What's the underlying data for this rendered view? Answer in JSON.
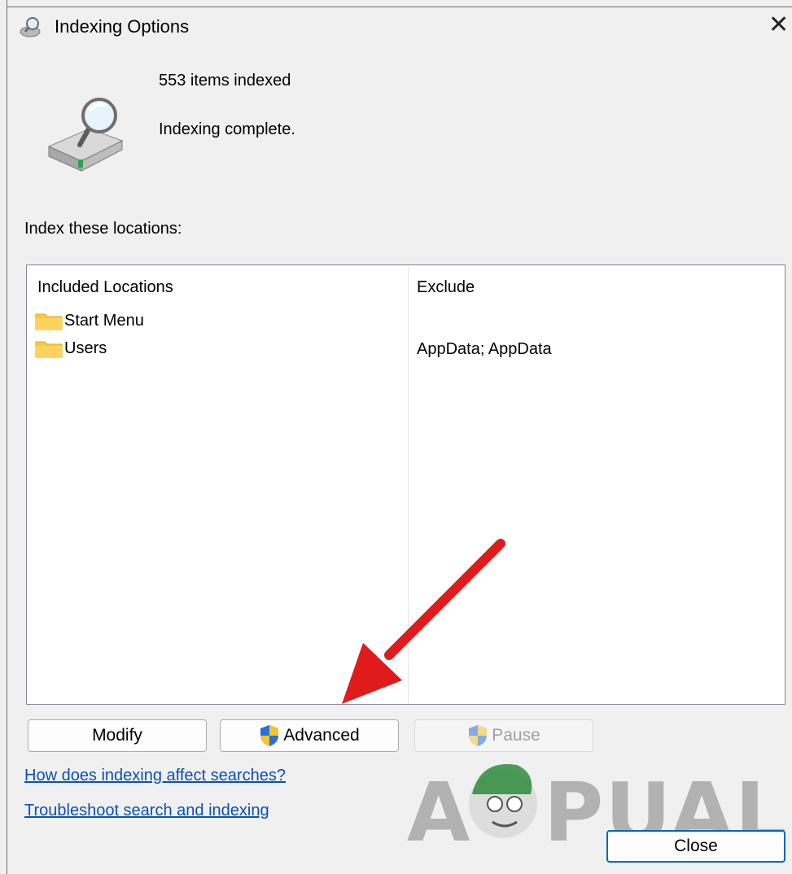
{
  "window": {
    "title": "Indexing Options",
    "close_glyph": "✕"
  },
  "status": {
    "items_indexed": "553 items indexed",
    "state": "Indexing complete."
  },
  "section_label": "Index these locations:",
  "table": {
    "headers": {
      "included": "Included Locations",
      "exclude": "Exclude"
    },
    "rows": [
      {
        "location": "Start Menu",
        "exclude": ""
      },
      {
        "location": "Users",
        "exclude": "AppData; AppData"
      }
    ]
  },
  "buttons": {
    "modify": "Modify",
    "advanced": "Advanced",
    "pause": "Pause",
    "close": "Close"
  },
  "links": {
    "help": "How does indexing affect searches?",
    "troubleshoot": "Troubleshoot search and indexing"
  },
  "watermark": {
    "text": "APPUALS"
  },
  "icons": {
    "title": "indexing-options-icon",
    "status": "search-drive-icon",
    "folder": "folder-icon",
    "shield": "uac-shield-icon",
    "arrow": "red-arrow-annotation"
  },
  "colors": {
    "link": "#0a50b8",
    "focus_border": "#0067c0",
    "arrow": "#e01b1b",
    "folder": "#f8c943"
  }
}
